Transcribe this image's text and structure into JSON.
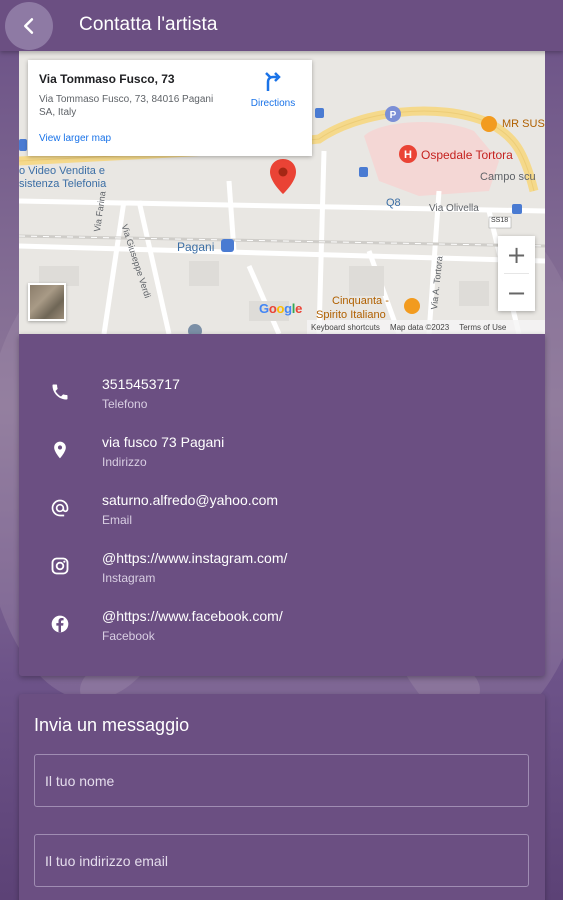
{
  "app_bar": {
    "title": "Contatta l'artista",
    "back_icon": "chevron-left-icon"
  },
  "map": {
    "info": {
      "title": "Via Tommaso Fusco, 73",
      "address": "Via Tommaso Fusco, 73, 84016 Pagani SA, Italy",
      "directions_label": "Directions",
      "larger_map_label": "View larger map"
    },
    "labels": {
      "ospedale": "Ospedale Tortora",
      "mr_sus": "MR SUS",
      "campo": "Campo scu",
      "video": "o Video Vendita e",
      "assistenza": "sistenza Telefonia",
      "via_olivella": "Via Olivella",
      "q8": "Q8",
      "pagani": "Pagani",
      "via_farina": "Via Farina",
      "via_verdi": "Via Giuseppe Verdi",
      "via_tortora": "Via A. Tortora",
      "cinquanta_1": "Cinquanta -",
      "cinquanta_2": "Spirito Italiano",
      "ss18": "SS18"
    },
    "zoom_in": "+",
    "zoom_out": "−",
    "attribution": {
      "shortcuts": "Keyboard shortcuts",
      "data": "Map data ©2023",
      "terms": "Terms of Use"
    },
    "colors": {
      "road_major": "#f5d98b",
      "hospital_area": "#f4d7d5",
      "pin": "#ea4335"
    }
  },
  "contacts": [
    {
      "icon": "phone-icon",
      "value": "3515453717",
      "label": "Telefono"
    },
    {
      "icon": "location-pin-icon",
      "value": "via fusco 73 Pagani",
      "label": "Indirizzo"
    },
    {
      "icon": "at-sign-icon",
      "value": "saturno.alfredo@yahoo.com",
      "label": "Email"
    },
    {
      "icon": "instagram-icon",
      "value": "@https://www.instagram.com/",
      "label": "Instagram"
    },
    {
      "icon": "facebook-icon",
      "value": "@https://www.facebook.com/",
      "label": "Facebook"
    }
  ],
  "message_form": {
    "title": "Invia un messaggio",
    "name_placeholder": "Il tuo nome",
    "email_placeholder": "Il tuo indirizzo email"
  },
  "theme": {
    "primary": "#6b4f82",
    "back_button": "#8e7aa4"
  }
}
